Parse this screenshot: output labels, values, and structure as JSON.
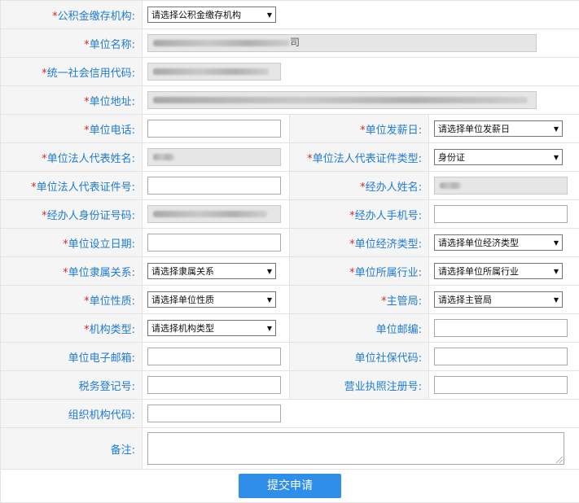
{
  "required_mark": "*",
  "labels": {
    "fund_org": "公积金缴存机构:",
    "unit_name": "单位名称:",
    "credit_code": "统一社会信用代码:",
    "address": "单位地址:",
    "phone": "单位电话:",
    "payday": "单位发薪日:",
    "legal_name": "单位法人代表姓名:",
    "legal_id_type": "单位法人代表证件类型:",
    "legal_id_no": "单位法人代表证件号:",
    "agent_name": "经办人姓名:",
    "agent_id": "经办人身份证号码:",
    "agent_mobile": "经办人手机号:",
    "setup_date": "单位设立日期:",
    "econ_type": "单位经济类型:",
    "affiliation": "单位隶属关系:",
    "industry": "单位所属行业:",
    "nature": "单位性质:",
    "authority": "主管局:",
    "org_type": "机构类型:",
    "postcode": "单位邮编:",
    "email": "单位电子邮箱:",
    "social_code": "单位社保代码:",
    "tax_no": "税务登记号:",
    "license_no": "营业执照注册号:",
    "org_code": "组织机构代码:",
    "remark": "备注:"
  },
  "selects": {
    "fund_org": "请选择公积金缴存机构",
    "payday": "请选择单位发薪日",
    "legal_id_type": "身份证",
    "econ_type": "请选择单位经济类型",
    "affiliation": "请选择隶属关系",
    "industry": "请选择单位所属行业",
    "nature": "请选择单位性质",
    "authority": "请选择主管局",
    "org_type": "请选择机构类型"
  },
  "readonly_values": {
    "unit_name_suffix": "司"
  },
  "submit_label": "提交申请"
}
